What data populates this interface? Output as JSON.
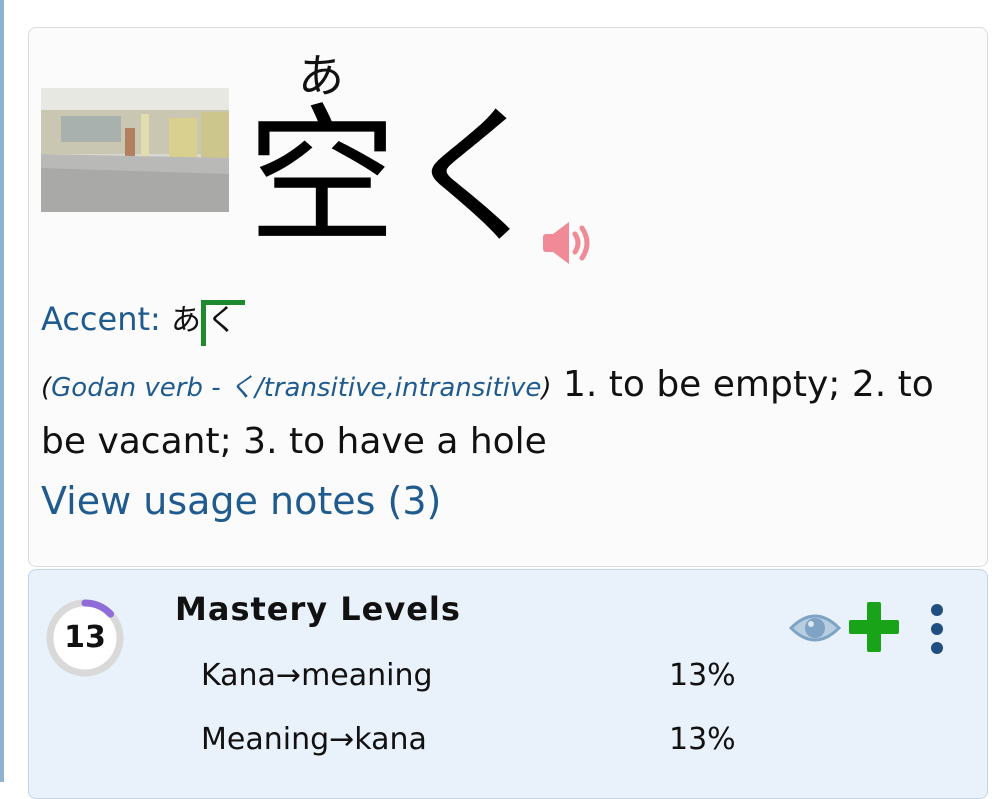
{
  "entry": {
    "furigana": "あ",
    "word": "空く",
    "accent_label": "Accent",
    "accent_colon": ":",
    "accent_kana_before": "あ",
    "accent_kana_marked": "く",
    "definition": {
      "paren_open": "(",
      "pos": "Godan verb - く/transitive,intransitive",
      "paren_close": ")",
      "text": " 1. to be empty; 2. to be vacant; 3. to have a hole"
    },
    "usage_link": "View usage notes (3)"
  },
  "mastery": {
    "level_number": "13",
    "progress_fraction": 0.13,
    "title": "Mastery Levels",
    "rows": [
      {
        "label": "Kana→meaning",
        "value": "13%"
      },
      {
        "label": "Meaning→kana",
        "value": "13%"
      }
    ]
  },
  "icons": {
    "speaker": "speaker-icon",
    "eye": "eye-icon",
    "plus": "plus-icon",
    "more": "more-vertical-icon"
  },
  "colors": {
    "link_blue": "#1f5b8e",
    "accent_green": "#1e8a2e",
    "speaker_pink": "#f08a96",
    "plus_green": "#19a319",
    "eye_blue": "#7fa3c4",
    "ring_purple": "#8f6cd8"
  }
}
